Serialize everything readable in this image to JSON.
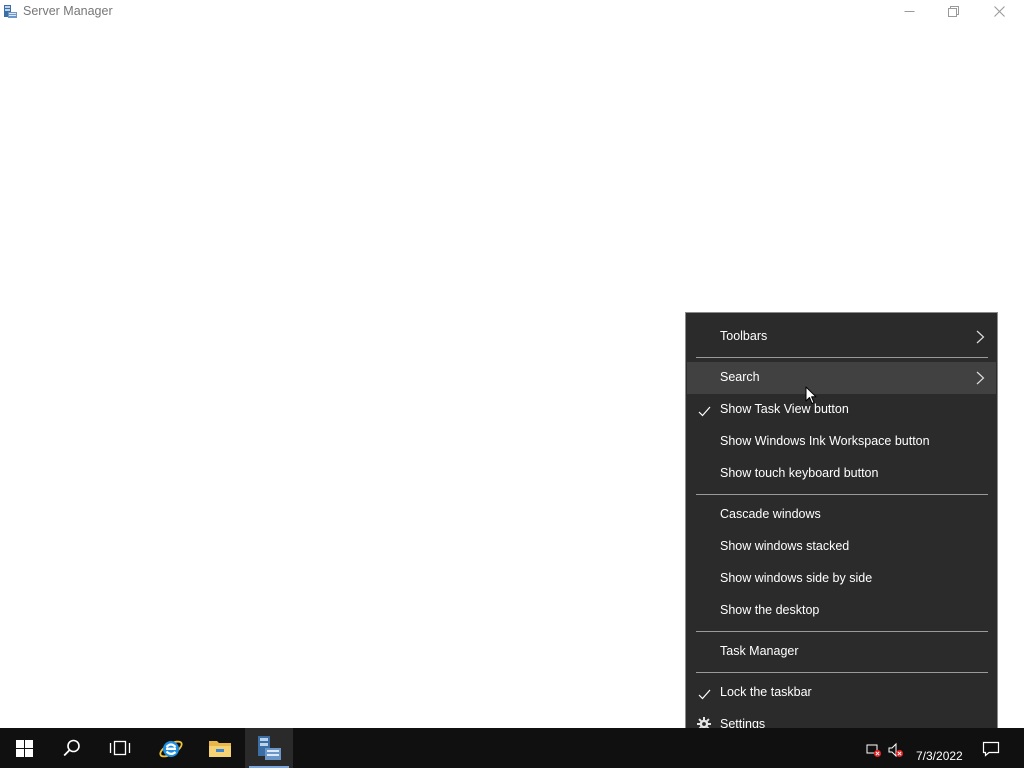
{
  "window": {
    "title": "Server Manager",
    "controls": {
      "minimize": "minimize-icon",
      "maximize": "restore-icon",
      "close": "close-icon"
    }
  },
  "context_menu": {
    "items": [
      {
        "label": "Toolbars",
        "submenu": true,
        "checked": false
      },
      {
        "label": "Search",
        "submenu": true,
        "checked": false,
        "highlighted": true
      },
      {
        "label": "Show Task View button",
        "checked": true
      },
      {
        "label": "Show Windows Ink Workspace button",
        "checked": false
      },
      {
        "label": "Show touch keyboard button",
        "checked": false
      },
      {
        "label": "Cascade windows",
        "checked": false
      },
      {
        "label": "Show windows stacked",
        "checked": false
      },
      {
        "label": "Show windows side by side",
        "checked": false
      },
      {
        "label": "Show the desktop",
        "checked": false
      },
      {
        "label": "Task Manager",
        "checked": false
      },
      {
        "label": "Lock the taskbar",
        "checked": true
      },
      {
        "label": "Settings",
        "icon": "gear-icon"
      }
    ]
  },
  "taskbar": {
    "buttons": [
      "windows-logo-icon",
      "search-icon",
      "task-view-icon",
      "internet-explorer-icon",
      "file-explorer-icon",
      "server-manager-icon"
    ],
    "active_app": "Server Manager",
    "clock_date": "7/3/2022"
  },
  "colors": {
    "menu_background": "#2b2b2b",
    "menu_highlight": "#414141",
    "taskbar_background": "#101010",
    "active_indicator": "#7aa7e0"
  }
}
